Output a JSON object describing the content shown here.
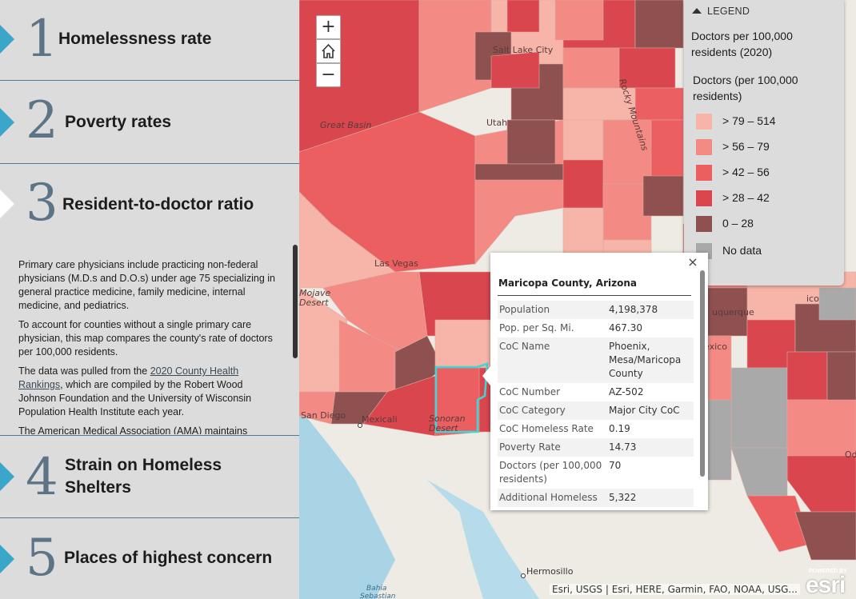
{
  "sidebar": {
    "sections": [
      {
        "number": "1",
        "title": "Homelessness rate"
      },
      {
        "number": "2",
        "title": "Poverty rates"
      },
      {
        "number": "3",
        "title": "Resident-to-doctor ratio",
        "paragraphs": [
          "Primary care physicians include practicing non-federal physicians (M.D.s and D.O.s) under age 75 specializing in general practice medicine, family medicine, internal medicine, and pediatrics.",
          "To account for counties without a single primary care physician, this map compares the county's rate of doctors per 100,000 residents."
        ],
        "p3_before": "The data was pulled from the ",
        "p3_link": "2020 County Health Rankings",
        "p3_after": ", which are compiled by the Robert Wood Johnson Foundation and the University of Wisconsin Population Health Institute each year.",
        "p4": "The American Medical Association (AMA) maintains"
      },
      {
        "number": "4",
        "title": "Strain on Homeless Shelters"
      },
      {
        "number": "5",
        "title": "Places of highest concern"
      }
    ]
  },
  "map": {
    "zoom_in": "+",
    "zoom_out": "−",
    "places": [
      "Salt Lake City",
      "Utah",
      "Great Basin",
      "Rocky Mountains",
      "Las Vegas",
      "Mojave Desert",
      "San Diego",
      "Mexicali",
      "Sonoran Desert",
      "Hermosillo",
      "Bahia Sebastian",
      "Albuquerque",
      "New Mexico",
      "Odes"
    ],
    "attribution": "Esri, USGS | Esri, HERE, Garmin, FAO, NOAA, USG...",
    "powered_by": "POWERED BY",
    "esri_logo": "esri"
  },
  "legend": {
    "header": "LEGEND",
    "layer_title": "Doctors per 100,000 residents (2020)",
    "field_title": "Doctors (per 100,000 residents)",
    "classes": [
      {
        "label": "> 79 – 514",
        "color": "#f6b5a8"
      },
      {
        "label": "> 56 – 79",
        "color": "#f38a84"
      },
      {
        "label": "> 42 – 56",
        "color": "#ec5f60"
      },
      {
        "label": "> 28 – 42",
        "color": "#d9464e"
      },
      {
        "label": "0 – 28",
        "color": "#8f5050"
      },
      {
        "label": "No data",
        "color": "#a9a9a9"
      }
    ]
  },
  "popup": {
    "title": "Maricopa County, Arizona",
    "close": "×",
    "rows": [
      {
        "key": "Population",
        "value": "4,198,378"
      },
      {
        "key": "Pop. per Sq. Mi.",
        "value": "467.30"
      },
      {
        "key": "CoC Name",
        "value": "Phoenix, Mesa/Maricopa County"
      },
      {
        "key": "CoC Number",
        "value": "AZ-502"
      },
      {
        "key": "CoC Category",
        "value": "Major City CoC"
      },
      {
        "key": "CoC Homeless Rate",
        "value": "0.19"
      },
      {
        "key": "Poverty Rate",
        "value": "14.73"
      },
      {
        "key": "Doctors (per 100,000 residents)",
        "value": "70"
      },
      {
        "key": "Additional Homeless",
        "value": "5,322"
      }
    ]
  },
  "colors": {
    "accent_arrow": "#3aa6c9",
    "highlight_outline": "#3fd6d6"
  }
}
